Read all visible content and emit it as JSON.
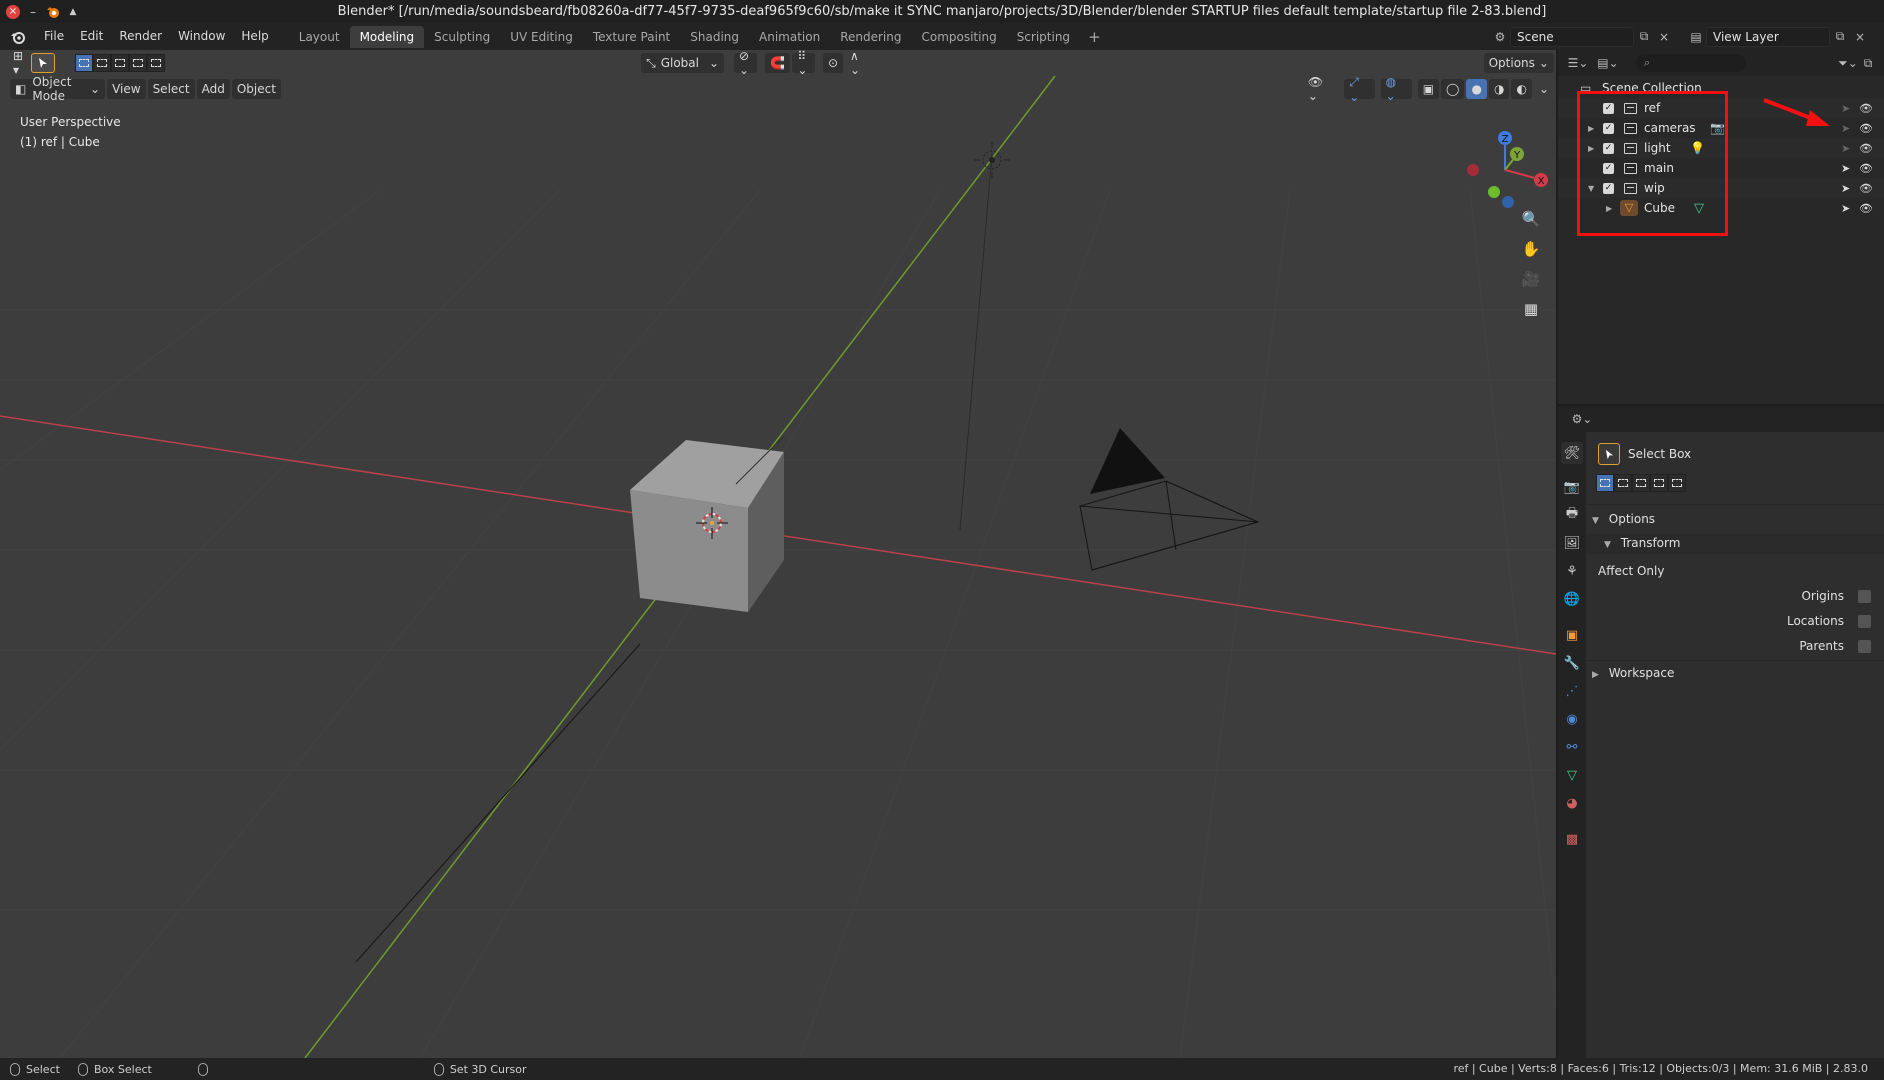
{
  "window": {
    "title": "Blender* [/run/media/soundsbeard/fb08260a-df77-45f7-9735-deaf965f9c60/sb/make it SYNC manjaro/projects/3D/Blender/blender STARTUP files default template/startup file 2-83.blend]"
  },
  "menu": {
    "items": [
      "File",
      "Edit",
      "Render",
      "Window",
      "Help"
    ]
  },
  "workspaces": {
    "tabs": [
      "Layout",
      "Modeling",
      "Sculpting",
      "UV Editing",
      "Texture Paint",
      "Shading",
      "Animation",
      "Rendering",
      "Compositing",
      "Scripting"
    ],
    "active": "Modeling",
    "add_label": "+"
  },
  "scene": {
    "name": "Scene"
  },
  "view_layer": {
    "name": "View Layer"
  },
  "viewport": {
    "header": {
      "transform_orientation": "Global",
      "options_label": "Options",
      "mode": "Object Mode",
      "menus": [
        "View",
        "Select",
        "Add",
        "Object"
      ]
    },
    "info": {
      "perspective": "User Perspective",
      "selection": "(1) ref | Cube"
    },
    "gizmo": {
      "z": "Z",
      "y": "Y",
      "x": "X"
    },
    "colors": {
      "x_axis": "#d23c4a",
      "y_axis": "#7ea33a",
      "z_axis": "#2f73c9",
      "grid_bg": "#3d3d3d"
    }
  },
  "outliner": {
    "root": "Scene Collection",
    "rows": [
      {
        "name": "ref",
        "type": "collection",
        "expander": "",
        "selectable": false
      },
      {
        "name": "cameras",
        "type": "collection",
        "expander": "▶",
        "selectable": false
      },
      {
        "name": "light",
        "type": "collection",
        "expander": "▶",
        "selectable": false
      },
      {
        "name": "main",
        "type": "collection",
        "expander": "",
        "selectable": true
      },
      {
        "name": "wip",
        "type": "collection",
        "expander": "▼",
        "selectable": true
      },
      {
        "name": "Cube",
        "type": "object",
        "expander": "▶",
        "selectable": true
      }
    ]
  },
  "properties": {
    "tool_name": "Select Box",
    "options_label": "Options",
    "transform_label": "Transform",
    "affect_only_label": "Affect Only",
    "affect_items": [
      {
        "label": "Origins",
        "checked": false
      },
      {
        "label": "Locations",
        "checked": false
      },
      {
        "label": "Parents",
        "checked": false
      }
    ],
    "workspace_label": "Workspace"
  },
  "statusbar": {
    "select_label": "Select",
    "box_select_label": "Box Select",
    "cursor_label": "Set 3D Cursor",
    "stats": "ref | Cube | Verts:8 | Faces:6 | Tris:12 | Objects:0/3 | Mem: 31.6 MiB | 2.83.0"
  }
}
